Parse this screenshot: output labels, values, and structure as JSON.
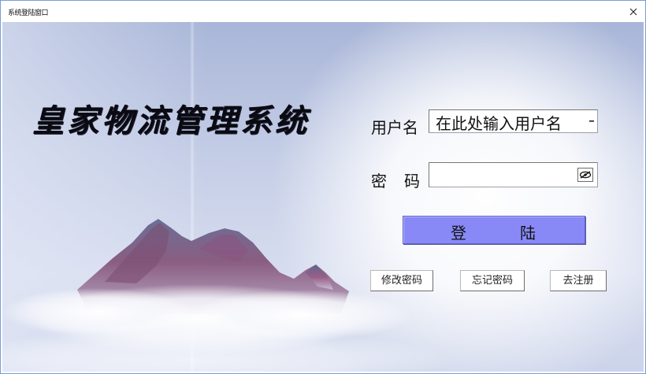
{
  "window": {
    "title": "系统登陆窗口",
    "close_glyph": "×"
  },
  "app": {
    "title": "皇家物流管理系统"
  },
  "form": {
    "username_label": "用户名",
    "username_value": "在此处输入用户名",
    "password_label_1": "密",
    "password_label_2": "码",
    "password_value": "",
    "login_label_1": "登",
    "login_label_2": "陆",
    "change_password_label": "修改密码",
    "forgot_password_label": "忘记密码",
    "register_label": "去注册"
  },
  "icons": {
    "combo_arrow": "chevron-down-icon",
    "eye": "eye-slash-icon",
    "close": "close-icon"
  },
  "colors": {
    "login_button": "#8889f7",
    "background_top": "#a9b6d8",
    "background_bottom": "#ccd4ea"
  }
}
